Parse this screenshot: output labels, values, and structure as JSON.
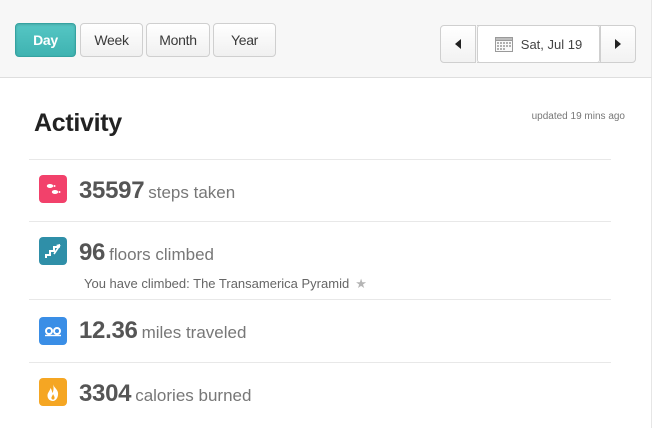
{
  "toolbar": {
    "ranges": [
      {
        "label": "Day",
        "active": true
      },
      {
        "label": "Week",
        "active": false
      },
      {
        "label": "Month",
        "active": false
      },
      {
        "label": "Year",
        "active": false
      }
    ],
    "date_label": "Sat, Jul 19",
    "icons": {
      "prev": "chevron-left-icon",
      "next": "chevron-right-icon",
      "calendar": "calendar-icon"
    }
  },
  "card": {
    "title": "Activity",
    "updated": "updated 19 mins ago"
  },
  "stats": [
    {
      "key": "steps",
      "value": "35597",
      "label": "steps taken",
      "icon": "footsteps-icon",
      "color": "#f2416b"
    },
    {
      "key": "floors",
      "value": "96",
      "label": "floors climbed",
      "icon": "stairs-icon",
      "color": "#2f8fa8",
      "sub": "You have climbed: The Transamerica Pyramid"
    },
    {
      "key": "distance",
      "value": "12.36",
      "label": "miles traveled",
      "icon": "distance-icon",
      "color": "#3a8ee6"
    },
    {
      "key": "calories",
      "value": "3304",
      "label": "calories burned",
      "icon": "flame-icon",
      "color": "#f5a623"
    }
  ],
  "colors": {
    "accent": "#45b9b7",
    "text_dark": "#222222",
    "text_muted": "#777777"
  }
}
